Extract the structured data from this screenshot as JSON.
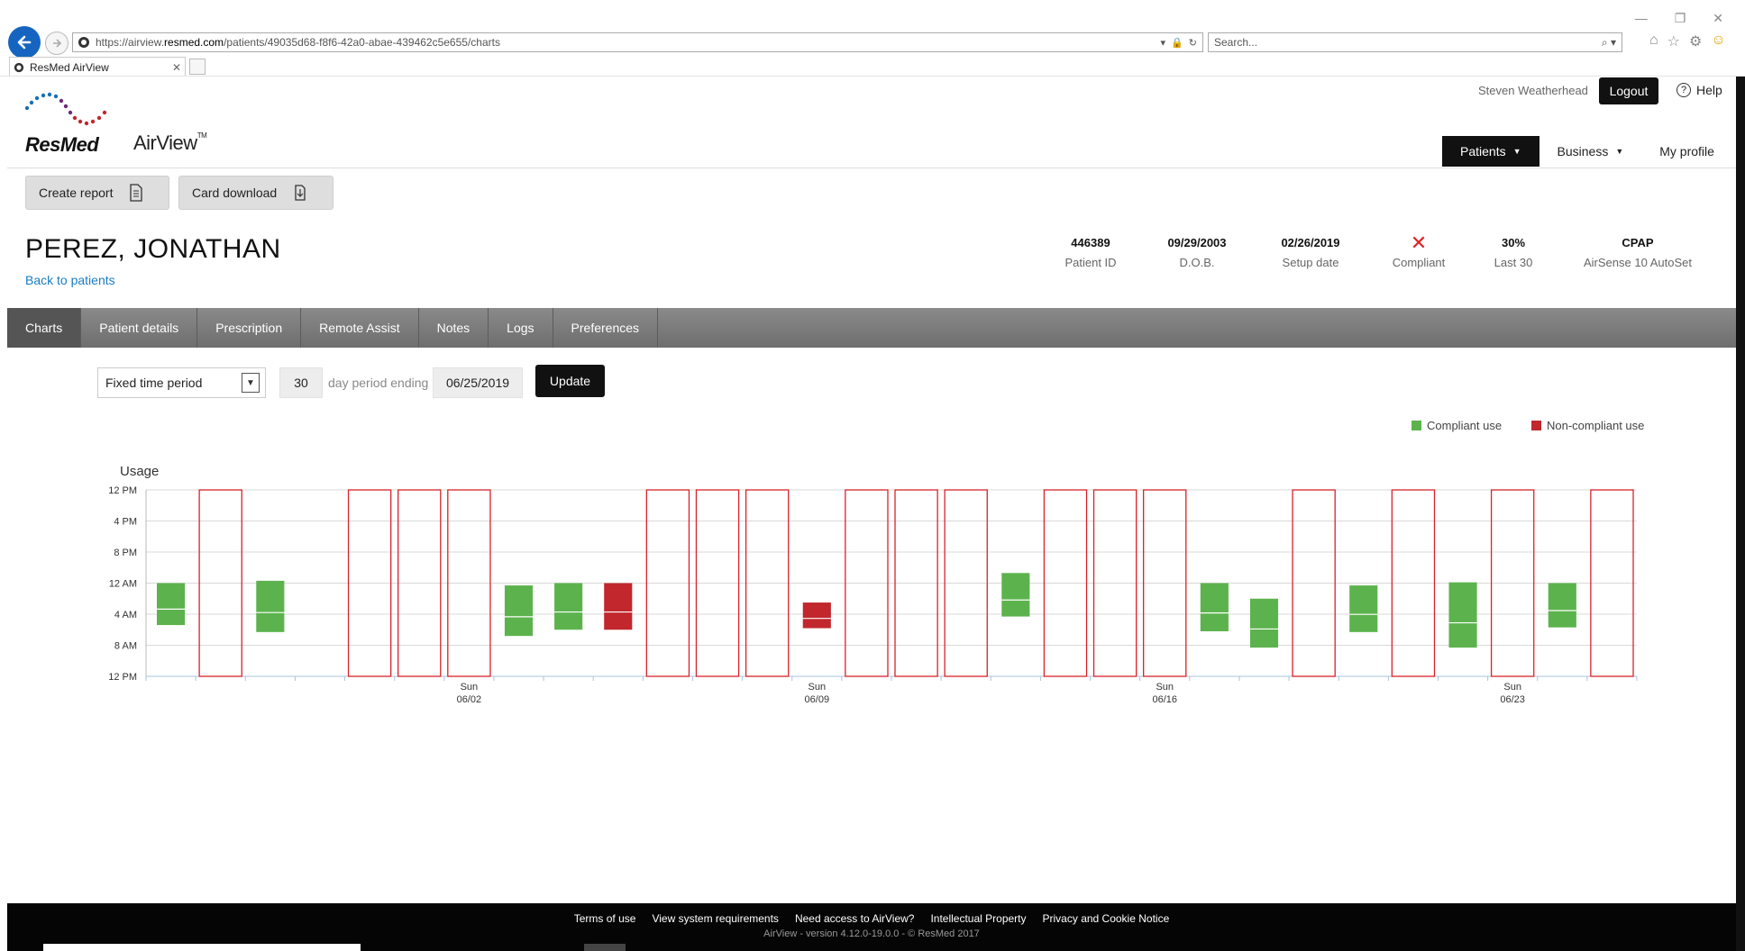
{
  "browser": {
    "url_prefix": "https://airview.",
    "url_domain": "resmed.com",
    "url_path": "/patients/49035d68-f8f6-42a0-abae-439462c5e655/charts",
    "search_placeholder": "Search...",
    "tab_title": "ResMed AirView"
  },
  "header": {
    "user_name": "Steven Weatherhead",
    "logout": "Logout",
    "help": "Help",
    "logo_resmed": "ResMed",
    "logo_airview": "AirView",
    "nav": {
      "patients": "Patients",
      "business": "Business",
      "my_profile": "My profile"
    }
  },
  "actions": {
    "create_report": "Create report",
    "card_download": "Card download"
  },
  "patient": {
    "name": "PEREZ, JONATHAN",
    "back_link": "Back to patients",
    "id_value": "446389",
    "id_label": "Patient ID",
    "dob_value": "09/29/2003",
    "dob_label": "D.O.B.",
    "setup_value": "02/26/2019",
    "setup_label": "Setup date",
    "compliant_mark": "✕",
    "compliant_label": "Compliant",
    "last30_value": "30%",
    "last30_label": "Last 30",
    "device_value": "CPAP",
    "device_label": "AirSense 10 AutoSet"
  },
  "tabs": [
    "Charts",
    "Patient details",
    "Prescription",
    "Remote Assist",
    "Notes",
    "Logs",
    "Preferences"
  ],
  "controls": {
    "period_type": "Fixed time period",
    "days": "30",
    "period_label": "day period ending",
    "end_date": "06/25/2019",
    "update": "Update"
  },
  "legend": {
    "compliant": "Compliant use",
    "noncompliant": "Non-compliant use",
    "compliant_color": "#5cb34d",
    "noncompliant_color": "#c1272d"
  },
  "chart_data": {
    "type": "bar",
    "title": "Usage",
    "y_tick_labels": [
      "12 PM",
      "4 PM",
      "8 PM",
      "12 AM",
      "4 AM",
      "8 AM",
      "12 PM"
    ],
    "x_tick_labels": [
      {
        "day": "Sun",
        "date": "06/02"
      },
      {
        "day": "Sun",
        "date": "06/09"
      },
      {
        "day": "Sun",
        "date": "06/16"
      },
      {
        "day": "Sun",
        "date": "06/23"
      }
    ],
    "sunday_index": [
      6,
      13,
      20,
      27
    ],
    "days": [
      {
        "date": "05/27",
        "status": "compliant",
        "start": 12.0,
        "end": 17.5
      },
      {
        "date": "05/28",
        "status": "none"
      },
      {
        "date": "05/29",
        "status": "compliant",
        "start": 11.8,
        "end": 18.3
      },
      {
        "date": "05/30",
        "status": "none",
        "empty": false
      },
      {
        "date": "05/31",
        "status": "none"
      },
      {
        "date": "06/01",
        "status": "none"
      },
      {
        "date": "06/02",
        "status": "none"
      },
      {
        "date": "06/03",
        "status": "compliant",
        "start": 12.5,
        "end": 18.8
      },
      {
        "date": "06/04",
        "status": "compliant",
        "start": 12.2,
        "end": 18.0
      },
      {
        "date": "06/05",
        "status": "noncompliant",
        "start": 12.3,
        "end": 18.2
      },
      {
        "date": "06/06",
        "status": "empty"
      },
      {
        "date": "06/07",
        "status": "none"
      },
      {
        "date": "06/08",
        "status": "none"
      },
      {
        "date": "06/09",
        "status": "none"
      },
      {
        "date": "06/10",
        "status": "noncompliant",
        "start": 14.5,
        "end": 17.8
      },
      {
        "date": "06/11",
        "status": "empty"
      },
      {
        "date": "06/12",
        "status": "none"
      },
      {
        "date": "06/13",
        "status": "none"
      },
      {
        "date": "06/14",
        "status": "none"
      },
      {
        "date": "06/15",
        "status": "compliant",
        "start": 10.6,
        "end": 16.3
      },
      {
        "date": "06/16",
        "status": "empty"
      },
      {
        "date": "06/17",
        "status": "none"
      },
      {
        "date": "06/18",
        "status": "none"
      },
      {
        "date": "06/19",
        "status": "none"
      },
      {
        "date": "06/20",
        "status": "compliant",
        "start": 12.0,
        "end": 18.1
      },
      {
        "date": "06/21",
        "status": "compliant",
        "start": 14.0,
        "end": 20.2
      },
      {
        "date": "06/22",
        "status": "empty"
      },
      {
        "date": "06/23",
        "status": "compliant",
        "start": 12.5,
        "end": 18.2
      },
      {
        "date": "06/24",
        "status": "none"
      },
      {
        "date": "06/25",
        "status": "none"
      }
    ],
    "no_data_days": [
      1,
      4,
      5,
      6,
      10,
      11,
      12,
      14,
      15,
      16,
      18,
      19,
      20,
      23,
      25,
      27,
      29
    ],
    "usage_days": [
      {
        "index": 0,
        "status": "compliant",
        "start_hour": 12.0,
        "end_hour": 17.4
      },
      {
        "index": 2,
        "status": "compliant",
        "start_hour": 11.7,
        "end_hour": 18.3
      },
      {
        "index": 7,
        "status": "compliant",
        "start_hour": 12.3,
        "end_hour": 18.8
      },
      {
        "index": 8,
        "status": "compliant",
        "start_hour": 12.0,
        "end_hour": 18.0
      },
      {
        "index": 9,
        "status": "noncompliant",
        "start_hour": 12.0,
        "end_hour": 18.0
      },
      {
        "index": 13,
        "status": "noncompliant",
        "start_hour": 14.5,
        "end_hour": 17.8
      },
      {
        "index": 17,
        "status": "compliant",
        "start_hour": 10.7,
        "end_hour": 16.3
      },
      {
        "index": 21,
        "status": "compliant",
        "start_hour": 12.0,
        "end_hour": 18.2
      },
      {
        "index": 22,
        "status": "compliant",
        "start_hour": 14.0,
        "end_hour": 20.3
      },
      {
        "index": 24,
        "status": "compliant",
        "start_hour": 12.3,
        "end_hour": 18.3
      },
      {
        "index": 26,
        "status": "compliant",
        "start_hour": 11.9,
        "end_hour": 20.3
      },
      {
        "index": 28,
        "status": "compliant",
        "start_hour": 12.0,
        "end_hour": 17.7
      }
    ],
    "y_range_hours": [
      0,
      24
    ],
    "grid": true
  },
  "footer": {
    "links": [
      "Terms of use",
      "View system requirements",
      "Need access to AirView?",
      "Intellectual Property",
      "Privacy and Cookie Notice"
    ],
    "version": "AirView - version 4.12.0-19.0.0  -  © ResMed 2017"
  }
}
